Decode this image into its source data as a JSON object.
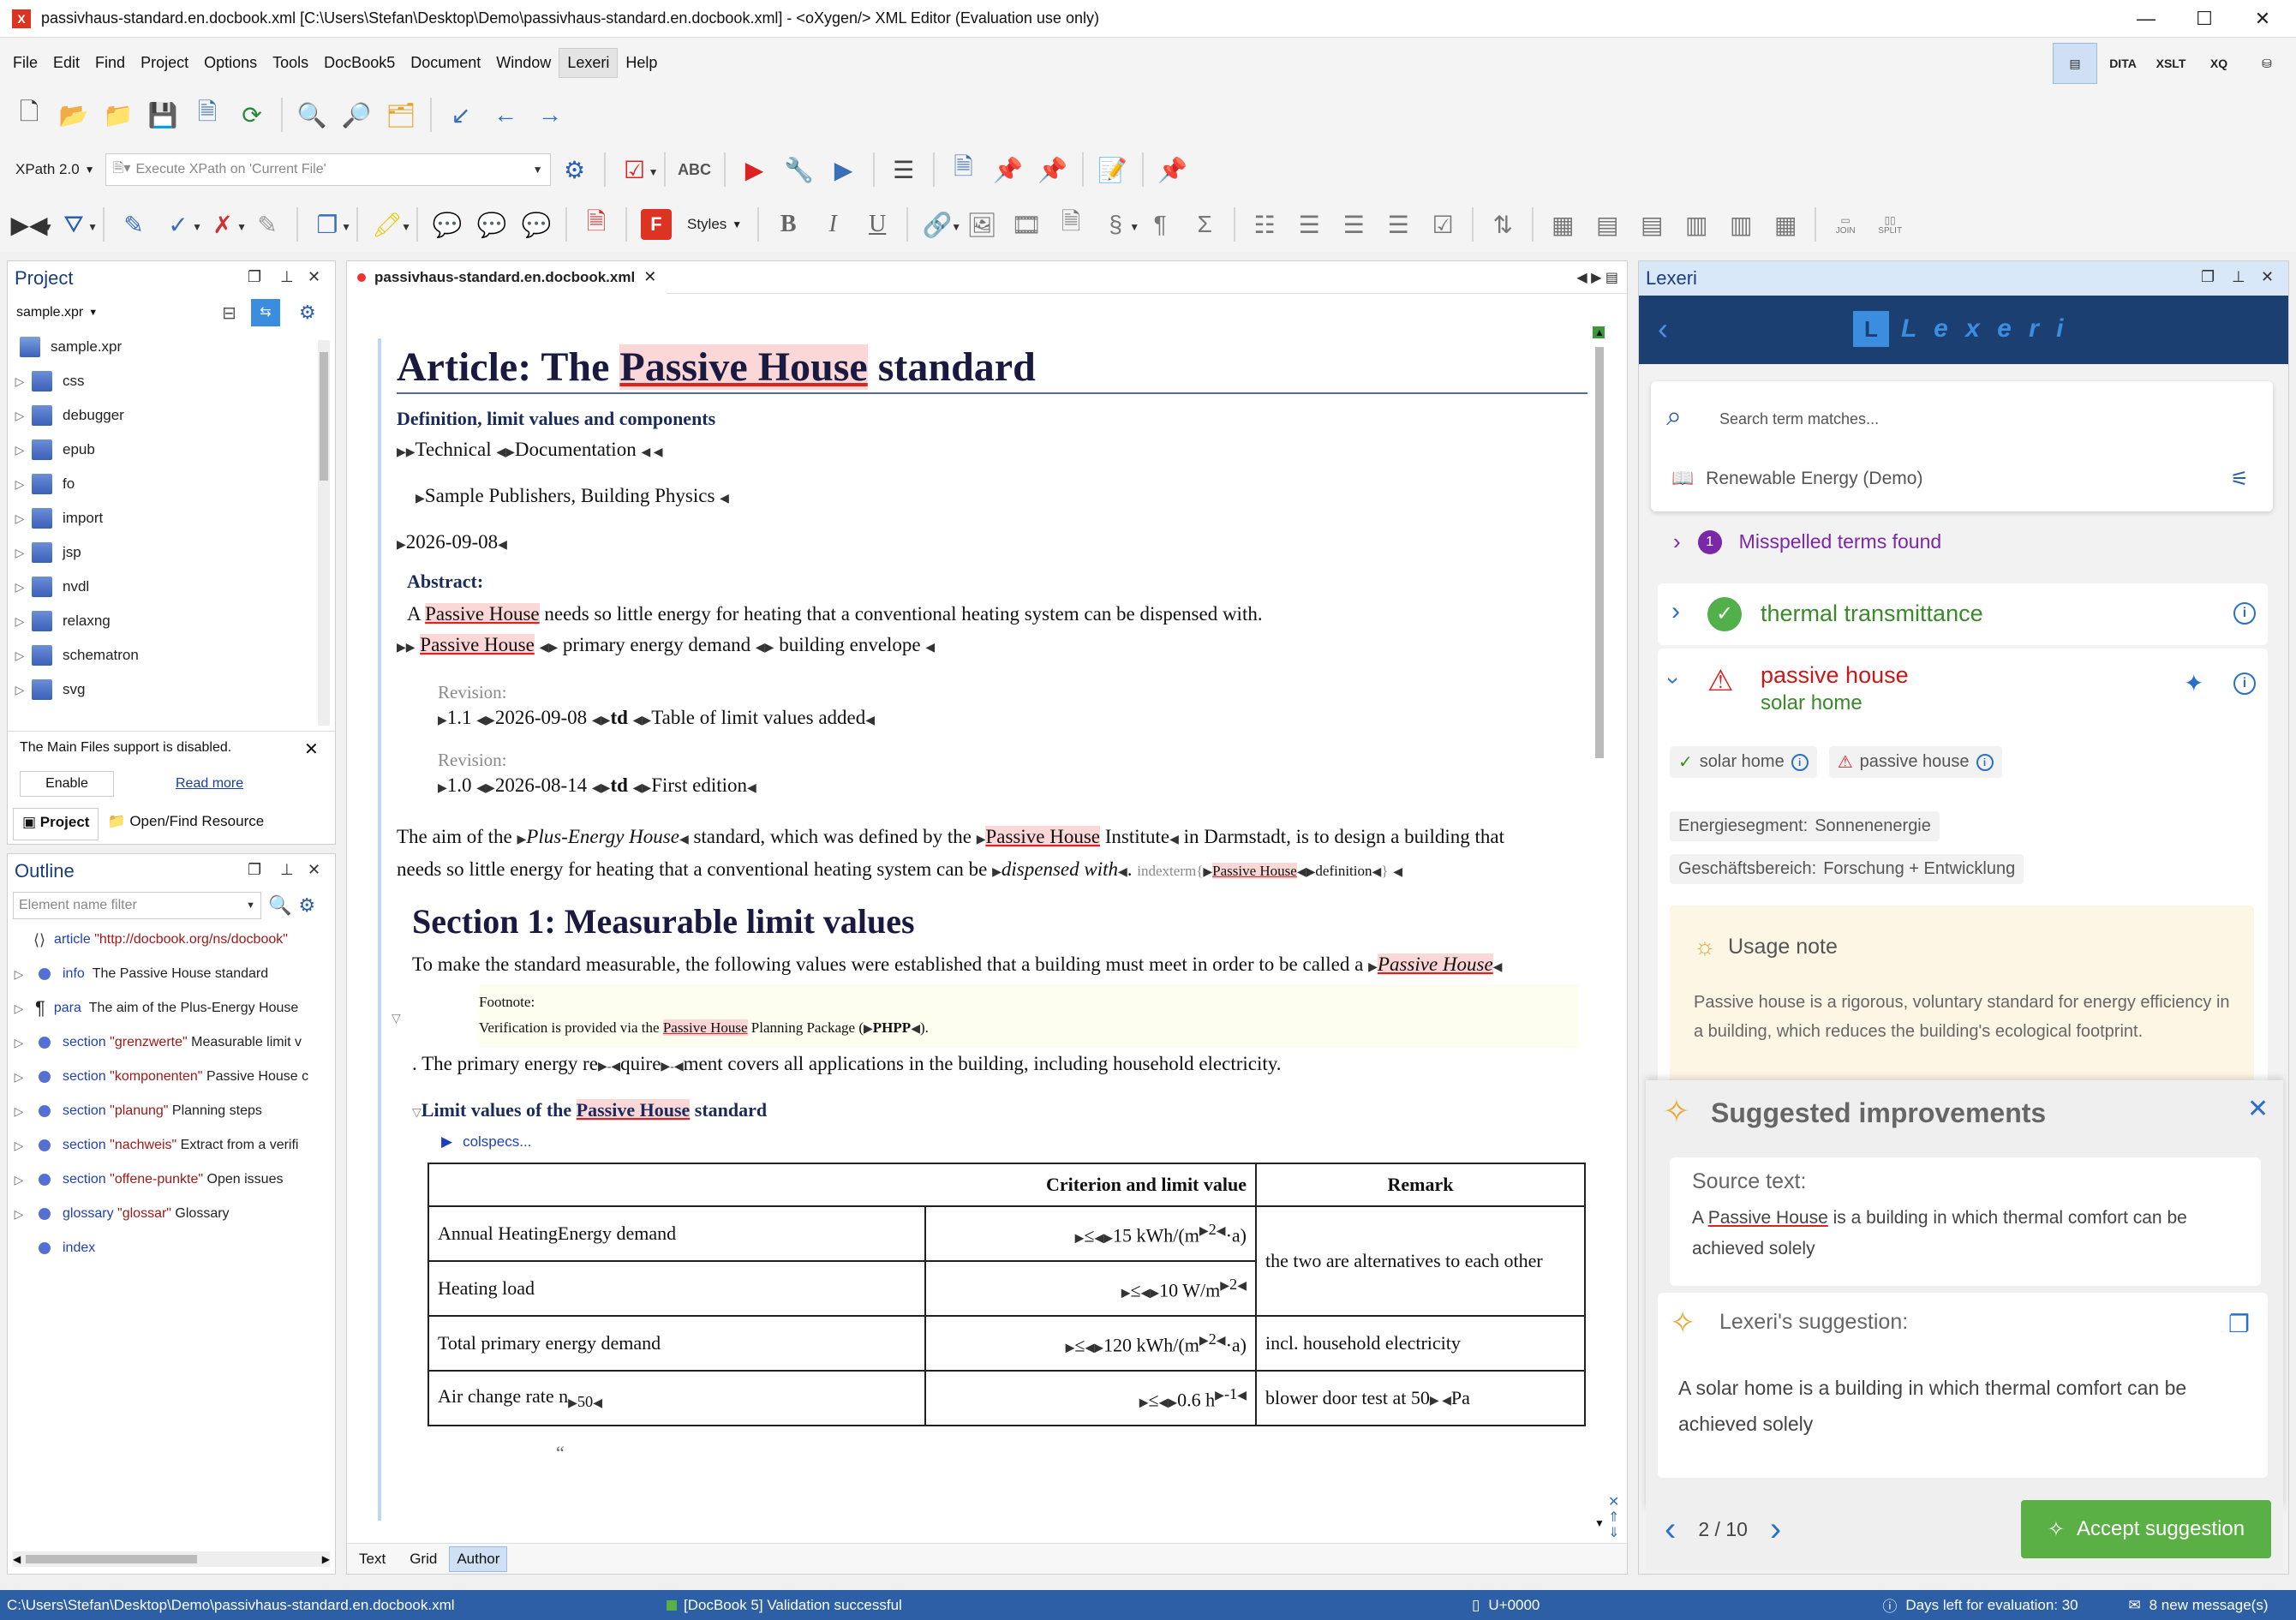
{
  "window": {
    "title": "passivhaus-standard.en.docbook.xml [C:\\Users\\Stefan\\Desktop\\Demo\\passivhaus-standard.en.docbook.xml] - <oXygen/> XML Editor (Evaluation use only)",
    "min": "—",
    "max": "☐",
    "close": "✕"
  },
  "menu": [
    "File",
    "Edit",
    "Find",
    "Project",
    "Options",
    "Tools",
    "DocBook5",
    "Document",
    "Window",
    "Lexeri",
    "Help"
  ],
  "perspectives": [
    "DITA",
    "XSLT",
    "XQ"
  ],
  "xpath": {
    "version": "XPath 2.0",
    "placeholder": "Execute XPath on  'Current File'"
  },
  "styles_label": "Styles",
  "project": {
    "title": "Project",
    "file": "sample.xpr",
    "root": "sample.xpr",
    "items": [
      "css",
      "debugger",
      "epub",
      "fo",
      "import",
      "jsp",
      "nvdl",
      "relaxng",
      "schematron",
      "svg"
    ],
    "mainfiles_msg": "The Main Files support is disabled.",
    "enable": "Enable",
    "read_more": "Read more",
    "tab_project": "Project",
    "tab_open": "Open/Find Resource"
  },
  "outline": {
    "title": "Outline",
    "filter_placeholder": "Element name filter",
    "rows": [
      {
        "kw": "article",
        "attr": "\"http://docbook.org/ns/docbook\"",
        "text": ""
      },
      {
        "kw": "info",
        "attr": "",
        "text": "The Passive House standard"
      },
      {
        "kw": "para",
        "attr": "",
        "text": "The aim of the Plus-Energy House"
      },
      {
        "kw": "section",
        "attr": "\"grenzwerte\"",
        "text": "Measurable limit v"
      },
      {
        "kw": "section",
        "attr": "\"komponenten\"",
        "text": "Passive House c"
      },
      {
        "kw": "section",
        "attr": "\"planung\"",
        "text": "Planning steps"
      },
      {
        "kw": "section",
        "attr": "\"nachweis\"",
        "text": "Extract from a verifi"
      },
      {
        "kw": "section",
        "attr": "\"offene-punkte\"",
        "text": "Open issues"
      },
      {
        "kw": "glossary",
        "attr": "\"glossar\"",
        "text": "Glossary"
      },
      {
        "kw": "index",
        "attr": "",
        "text": ""
      }
    ]
  },
  "editor": {
    "tab": "passivhaus-standard.en.docbook.xml",
    "h1_pre": "Article: The ",
    "h1_term": "Passive House",
    "h1_post": " standard",
    "subtitle": "Definition, limit values and components",
    "keywords": [
      "Technical",
      "Documentation"
    ],
    "publisher": "Sample Publishers, Building Physics",
    "date": "2026-09-08",
    "abstract_label": "Abstract:",
    "abstract_pre": "A ",
    "abstract_term": "Passive House",
    "abstract_post": " needs so little energy for heating that a conventional heating system can be dispensed with.",
    "terms": [
      "Passive House",
      "primary energy demand",
      "building envelope"
    ],
    "rev_label": "Revision:",
    "rev1": {
      "num": "1.1",
      "date": "2026-09-08",
      "td": "td",
      "text": "Table of limit values added"
    },
    "rev2": {
      "num": "1.0",
      "date": "2026-08-14",
      "td": "td",
      "text": "First edition"
    },
    "para_a": "The aim of the ",
    "para_b": "Plus-Energy House",
    "para_c": " standard, which was defined by the ",
    "para_term": "Passive House",
    "para_d": " Institute",
    "para_e": " in Darmstadt, is to design a building that",
    "para2_a": "needs so little energy for heating that a conventional heating system can be ",
    "para2_em": "dispensed with",
    "para2_b": ".",
    "indexterm": "indexterm{",
    "idx_term": "Passive House",
    "idx_def": "definition",
    "idx_close": "}",
    "h2": "Section 1: Measurable limit values",
    "s1_a": "To make the standard measurable, the following values were established that a building must meet in order to be called a ",
    "s1_term": "Passive House",
    "footnote_label": "Footnote:",
    "fn_a": "Verification is provided via the ",
    "fn_term": "Passive House",
    "fn_b": " Planning Package (",
    "fn_code": "PHPP",
    "fn_c": ").",
    "s1_p2_a": ". The primary energy re",
    "s1_p2_b": "quire",
    "s1_p2_c": "ment covers all applications in the building, including household electricity.",
    "h3_pre": "Limit values of the ",
    "h3_term": "Passive House",
    "h3_post": " standard",
    "colspecs": "colspecs...",
    "table": {
      "h_criterion": "Criterion and limit value",
      "h_remark": "Remark",
      "rows": [
        [
          "Annual HeatingEnergy demand",
          "≤",
          "15 kWh/(m",
          "2",
          "·a)"
        ],
        [
          "Heating load",
          "≤",
          "10 W/m",
          "2",
          ""
        ],
        [
          "Total primary energy demand",
          "≤",
          "120 kWh/(m",
          "2",
          "·a)"
        ],
        [
          "Air change rate n",
          "≤",
          "0.6 h",
          "-1",
          ""
        ]
      ],
      "n_sub": "50",
      "remark1": "the two are alternatives to each other",
      "remark3": "incl. household electricity",
      "remark4_a": "blower door test at 50",
      "remark4_b": "Pa"
    },
    "quote_mark": "“",
    "modes": [
      "Text",
      "Grid",
      "Author"
    ]
  },
  "lexeri": {
    "title": "Lexeri",
    "logo": "L e x e r i",
    "search_placeholder": "Search term matches...",
    "glossary": "Renewable Energy (Demo)",
    "misspelled_count": "1",
    "misspelled": "Misspelled terms found",
    "term_ok": "thermal transmittance",
    "term_bad": "passive house",
    "term_pref": "solar home",
    "chip_ok": "solar home",
    "chip_bad": "passive house",
    "meta1_k": "Energiesegment:",
    "meta1_v": "Sonnenenergie",
    "meta2_k": "Geschäftsbereich:",
    "meta2_v": "Forschung + Entwicklung",
    "usage_title": "Usage note",
    "usage_text": "Passive house is a rigorous, voluntary standard for energy efficiency in a building, which reduces the building's ecological footprint.",
    "sugg_title": "Suggested improvements",
    "source_label": "Source text:",
    "source_a": "A ",
    "source_term": "Passive House",
    "source_b": " is a building in which thermal comfort can be achieved solely",
    "sugg_label": "Lexeri's suggestion:",
    "sugg_text": "A solar home is a building in which thermal comfort can be achieved solely",
    "pager": "2 / 10",
    "accept": "Accept suggestion"
  },
  "status": {
    "path": "C:\\Users\\Stefan\\Desktop\\Demo\\passivhaus-standard.en.docbook.xml",
    "validation": "[DocBook 5] Validation successful",
    "unicode": "U+0000",
    "days": "Days left for evaluation: 30",
    "messages": "8 new message(s)"
  }
}
